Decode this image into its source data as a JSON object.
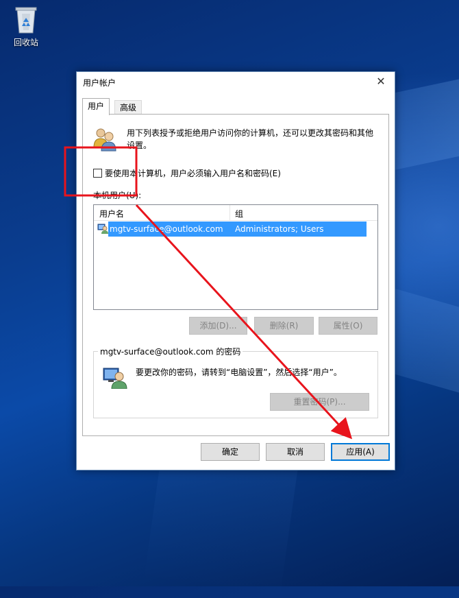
{
  "desktop": {
    "recycle_bin_label": "回收站"
  },
  "dialog": {
    "title": "用户帐户",
    "close_glyph": "✕",
    "tabs": [
      {
        "label": "用户"
      },
      {
        "label": "高级"
      }
    ],
    "description": "用下列表授予或拒绝用户访问你的计算机，还可以更改其密码和其他设置。",
    "must_login_checkbox": {
      "label": "要使用本计算机，用户必须输入用户名和密码(E)",
      "checked": false
    },
    "local_users_label": "本机用户(U):",
    "list": {
      "columns": [
        "用户名",
        "组"
      ],
      "rows": [
        {
          "name": "mgtv-surface@outlook.com",
          "group": "Administrators; Users",
          "selected": true
        }
      ]
    },
    "buttons": {
      "add": "添加(D)...",
      "remove": "删除(R)",
      "properties": "属性(O)"
    },
    "password_section": {
      "title": "mgtv-surface@outlook.com 的密码",
      "text": "要更改你的密码，请转到“电脑设置”，然后选择“用户”。",
      "reset_button": "重置密码(P)..."
    },
    "footer": {
      "ok": "确定",
      "cancel": "取消",
      "apply": "应用(A)"
    }
  },
  "annotation": {
    "color": "#e8141c"
  },
  "icons": [
    "recycle-bin-icon",
    "users-icon",
    "user-account-icon",
    "user-monitor-icon",
    "close-icon"
  ]
}
